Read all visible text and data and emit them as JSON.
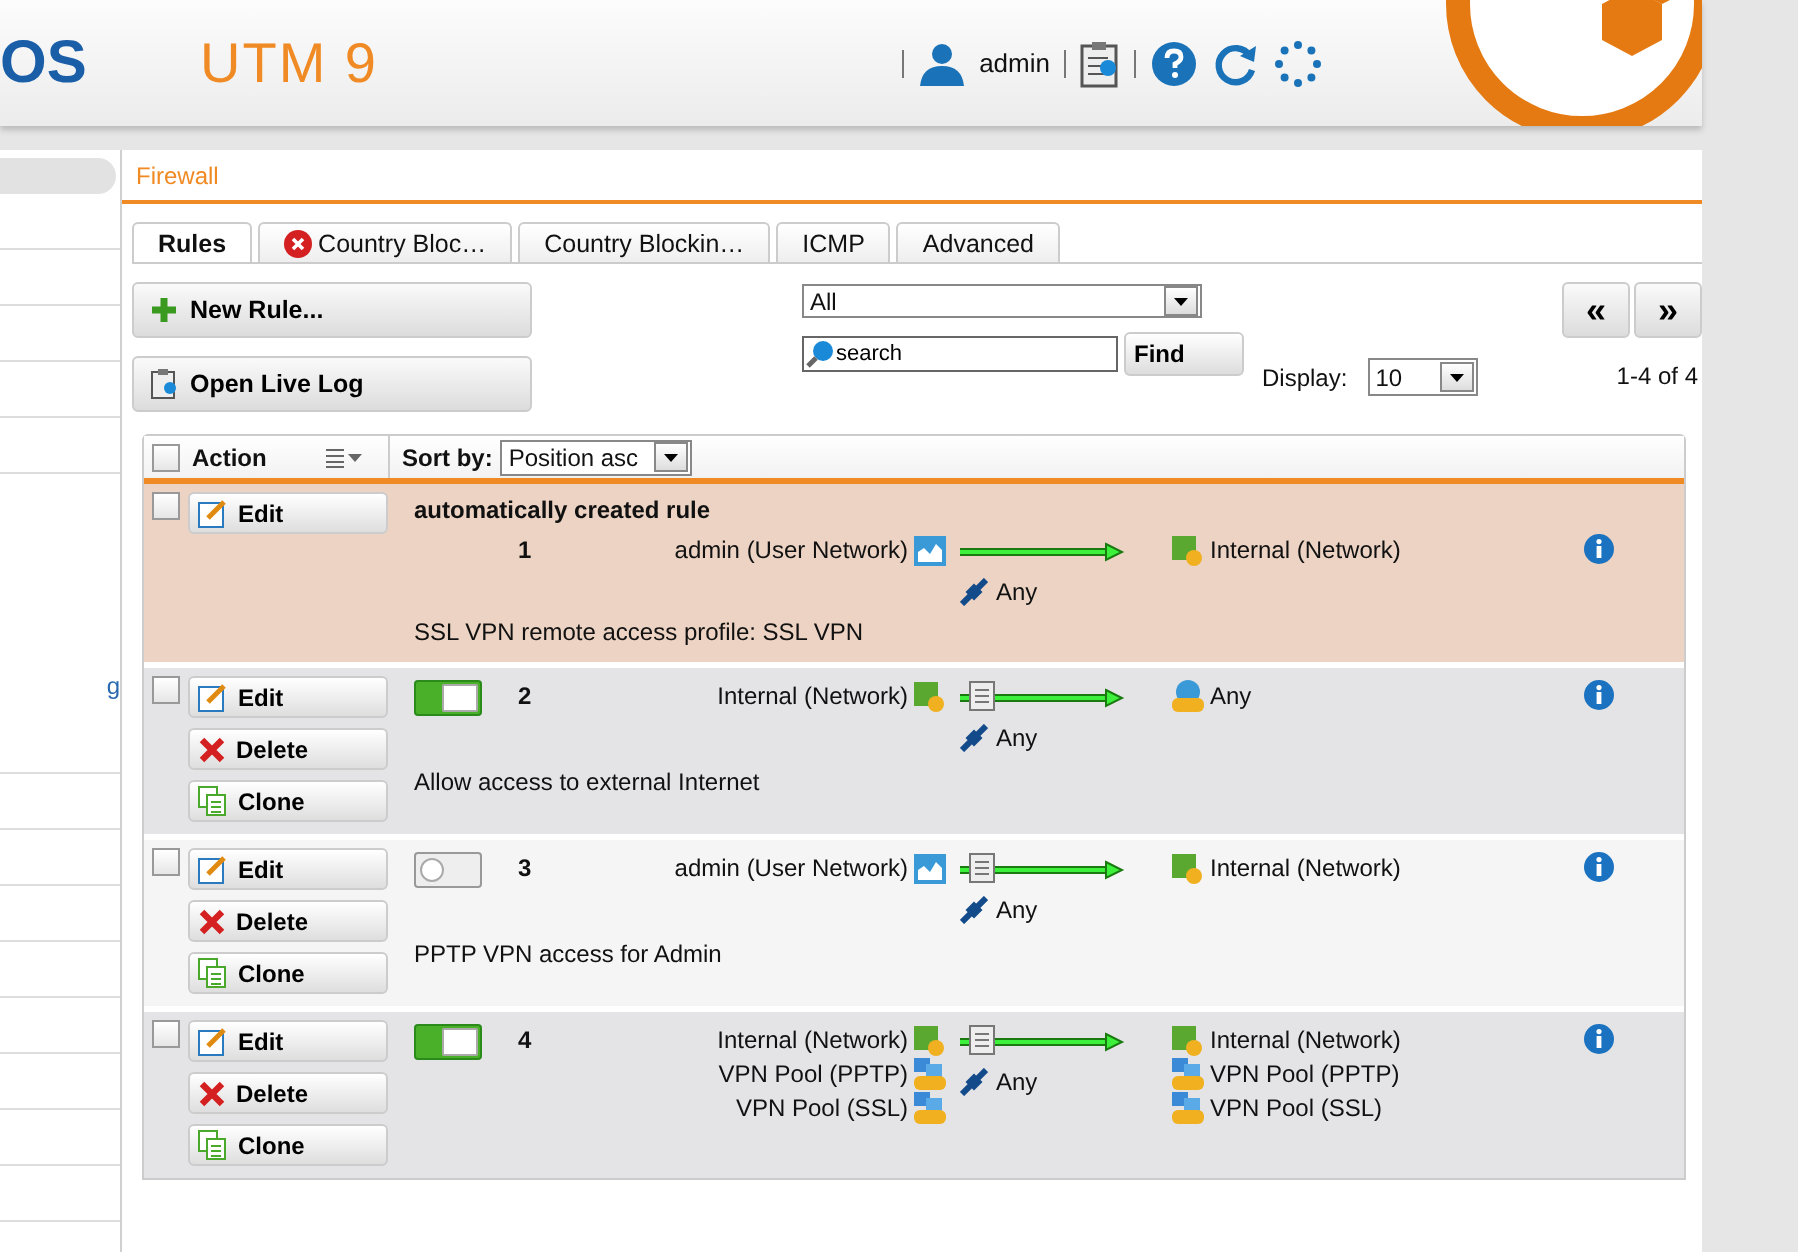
{
  "header": {
    "logo": "OS",
    "product": "UTM 9",
    "user": "admin"
  },
  "sidebar": {
    "items": [
      {
        "label": "g"
      }
    ]
  },
  "breadcrumb": "Firewall",
  "tabs": [
    {
      "label": "Rules",
      "selected": true,
      "error": false
    },
    {
      "label": "Country Bloc…",
      "selected": false,
      "error": true
    },
    {
      "label": "Country Blockin…",
      "selected": false,
      "error": false
    },
    {
      "label": "ICMP",
      "selected": false,
      "error": false
    },
    {
      "label": "Advanced",
      "selected": false,
      "error": false
    }
  ],
  "toolbar": {
    "new_rule": "New Rule...",
    "live_log": "Open Live Log",
    "filter": "All",
    "search": {
      "placeholder": "search"
    },
    "find": "Find",
    "display_label": "Display:",
    "display_value": "10",
    "prev": "«",
    "next": "»",
    "range": "1-4 of 4"
  },
  "table": {
    "select_all_checked": false,
    "action_header": "Action",
    "sort_label": "Sort by:",
    "sort_value": "Position asc",
    "rules": [
      {
        "kind": "auto",
        "checked": false,
        "title": "automatically created rule",
        "number": "1",
        "actions": [
          "Edit"
        ],
        "sources": [
          {
            "label": "admin (User Network)",
            "kind": "user"
          }
        ],
        "services": [
          "Any"
        ],
        "destinations": [
          {
            "label": "Internal (Network)",
            "kind": "network"
          }
        ],
        "comment": "SSL VPN remote access profile: SSL VPN"
      },
      {
        "kind": "user",
        "checked": false,
        "enabled": true,
        "number": "2",
        "actions": [
          "Edit",
          "Delete",
          "Clone"
        ],
        "sources": [
          {
            "label": "Internal (Network)",
            "kind": "network"
          }
        ],
        "services": [
          "Any"
        ],
        "destinations": [
          {
            "label": "Any",
            "kind": "internet"
          }
        ],
        "comment": "Allow access to external Internet"
      },
      {
        "kind": "user",
        "checked": false,
        "enabled": false,
        "number": "3",
        "actions": [
          "Edit",
          "Delete",
          "Clone"
        ],
        "sources": [
          {
            "label": "admin (User Network)",
            "kind": "user"
          }
        ],
        "services": [
          "Any"
        ],
        "destinations": [
          {
            "label": "Internal (Network)",
            "kind": "network"
          }
        ],
        "comment": "PPTP VPN access for Admin"
      },
      {
        "kind": "user",
        "checked": false,
        "enabled": true,
        "number": "4",
        "actions": [
          "Edit",
          "Delete",
          "Clone"
        ],
        "sources": [
          {
            "label": "Internal (Network)",
            "kind": "network"
          },
          {
            "label": "VPN Pool (PPTP)",
            "kind": "pool"
          },
          {
            "label": "VPN Pool (SSL)",
            "kind": "pool"
          }
        ],
        "services": [
          "Any"
        ],
        "destinations": [
          {
            "label": "Internal (Network)",
            "kind": "network"
          },
          {
            "label": "VPN Pool (PPTP)",
            "kind": "pool"
          },
          {
            "label": "VPN Pool (SSL)",
            "kind": "pool"
          }
        ]
      }
    ]
  }
}
